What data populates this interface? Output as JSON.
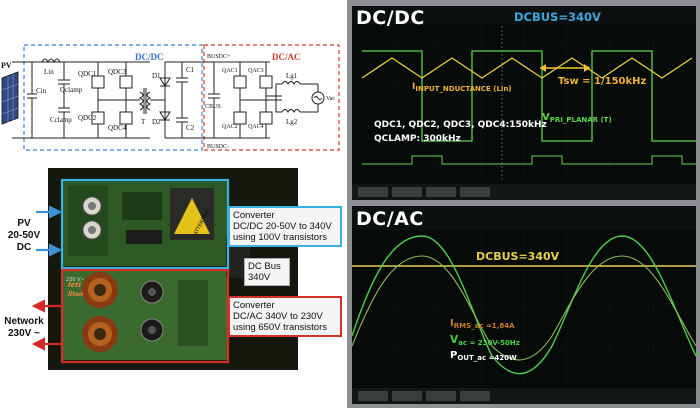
{
  "schematic": {
    "dcdc_label": "DC/DC",
    "dcac_label": "DC/AC",
    "pv_label": "PV",
    "components": {
      "lin": "Lin",
      "cin": "Cin",
      "qclamp": "Qclamp",
      "cclamp": "Cclamp",
      "qdc1": "QDC1",
      "qdc2": "QDC2",
      "qdc3": "QDC3",
      "qdc4": "QDC4",
      "t": "T",
      "d1": "D1",
      "d2": "D2",
      "c1": "C1",
      "c2": "C2",
      "busdc_plus": "BUSDC+",
      "busdc_minus": "BUSDC-",
      "cbus": "CBUS",
      "qac1": "QAC1",
      "qac2": "QAC2",
      "qac3": "QAC3",
      "qac4": "QAC4",
      "lg1": "Lg1",
      "lg2": "Lg2",
      "vac": "Vac"
    }
  },
  "photo": {
    "pv_input": "PV\n20-50V DC",
    "network": "Network\n230V ~",
    "dcdc_note": "Converter\nDC/DC 20-50V to 340V\nusing 100V transistors",
    "dcbus_note": "DC Bus\n340V",
    "dcac_note": "Converter\nDC/AC 340V to 230V\nusing 650V transistors",
    "board_text_1": "230 V~",
    "board_text_2": "leti",
    "board_text_3": "liten",
    "sticker": "ATTENTION"
  },
  "scope_dcdc": {
    "title": "DC/DC",
    "dcbus": "DCBUS=340V",
    "i_input": "INPUT_NDUCTANCE (Lin)",
    "i_prefix": "I",
    "tsw": "Tsw = 1/150kHz",
    "q_line": "QDC1, QDC2, QDC3, QDC4:150kHz",
    "q_clamp": "QCLAMP: 300kHz",
    "v_pri": "PRI_PLANAR (T)",
    "v_prefix": "V",
    "colors": {
      "yellow": "#e6d23c",
      "green": "#5ed34a",
      "blue": "#3fa6e0"
    }
  },
  "scope_dcac": {
    "title": "DC/AC",
    "dcbus": "DCBUS=340V",
    "irms": "RMS_ac =1,84A",
    "irms_prefix": "I",
    "vac": "ac = 230V-50Hz",
    "vac_prefix": "V",
    "pout": "OUT_ac =420W",
    "pout_prefix": "P",
    "colors": {
      "yellow": "#e8d04a",
      "green": "#4bd04a",
      "orange": "#c87c2a"
    }
  }
}
